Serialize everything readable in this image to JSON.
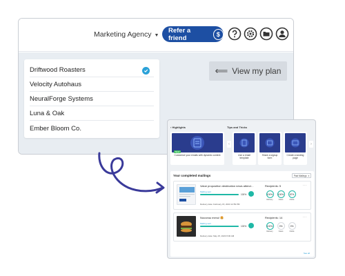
{
  "header": {
    "account_name": "Marketing Agency",
    "refer_label": "Refer a friend",
    "refer_icon_glyph": "$",
    "icons": [
      "help-icon",
      "settings-icon",
      "folder-icon",
      "user-icon"
    ]
  },
  "clients": {
    "items": [
      {
        "label": "Driftwood Roasters",
        "selected": true
      },
      {
        "label": "Velocity Autohaus",
        "selected": false
      },
      {
        "label": "NeuralForge Systems",
        "selected": false
      },
      {
        "label": "Luna & Oak",
        "selected": false
      },
      {
        "label": "Ember Bloom Co.",
        "selected": false
      }
    ]
  },
  "plan_button": {
    "label": "View my plan"
  },
  "dashboard": {
    "highlights_label": "› Highlights",
    "tips_label": "Tips and Tricks",
    "new_badge": "New",
    "cards": [
      {
        "caption": "Customize your emails with dynamic content"
      },
      {
        "caption": "Use a email template"
      },
      {
        "caption": "Share a signup form"
      },
      {
        "caption": "Create a landing page"
      }
    ],
    "mailings_title": "Your completed mailings",
    "filter_label": "Past Mailings",
    "mailings": [
      {
        "title": "Value proposition destination news attend…",
        "status": "Mailing sent",
        "progress": 1.0,
        "progress_label": "100%",
        "delivery": "Delivery date: February 15, 2023 12:59 PM",
        "recipients": "Recipients: 5",
        "stats": [
          {
            "value": "100%",
            "label": "Delivery"
          },
          {
            "value": "100%",
            "label": "Views"
          },
          {
            "value": "67%",
            "label": "Clicks"
          }
        ]
      },
      {
        "title": "Nouveau menu! 🍔",
        "status": "Mailing sent",
        "progress": 1.0,
        "progress_label": "100%",
        "delivery": "Delivery date: May 15, 2023 8:00 AM",
        "recipients": "Recipients: 14",
        "stats": [
          {
            "value": "100%",
            "label": "Delivery"
          },
          {
            "value": "0%",
            "label": "Views"
          },
          {
            "value": "0%",
            "label": "Clicks"
          }
        ]
      }
    ],
    "see_all": "See all"
  },
  "colors": {
    "accent": "#1d4fa3",
    "check": "#2aa1d8",
    "teal": "#1fb8a6",
    "panel_bg": "#e8edf2"
  }
}
